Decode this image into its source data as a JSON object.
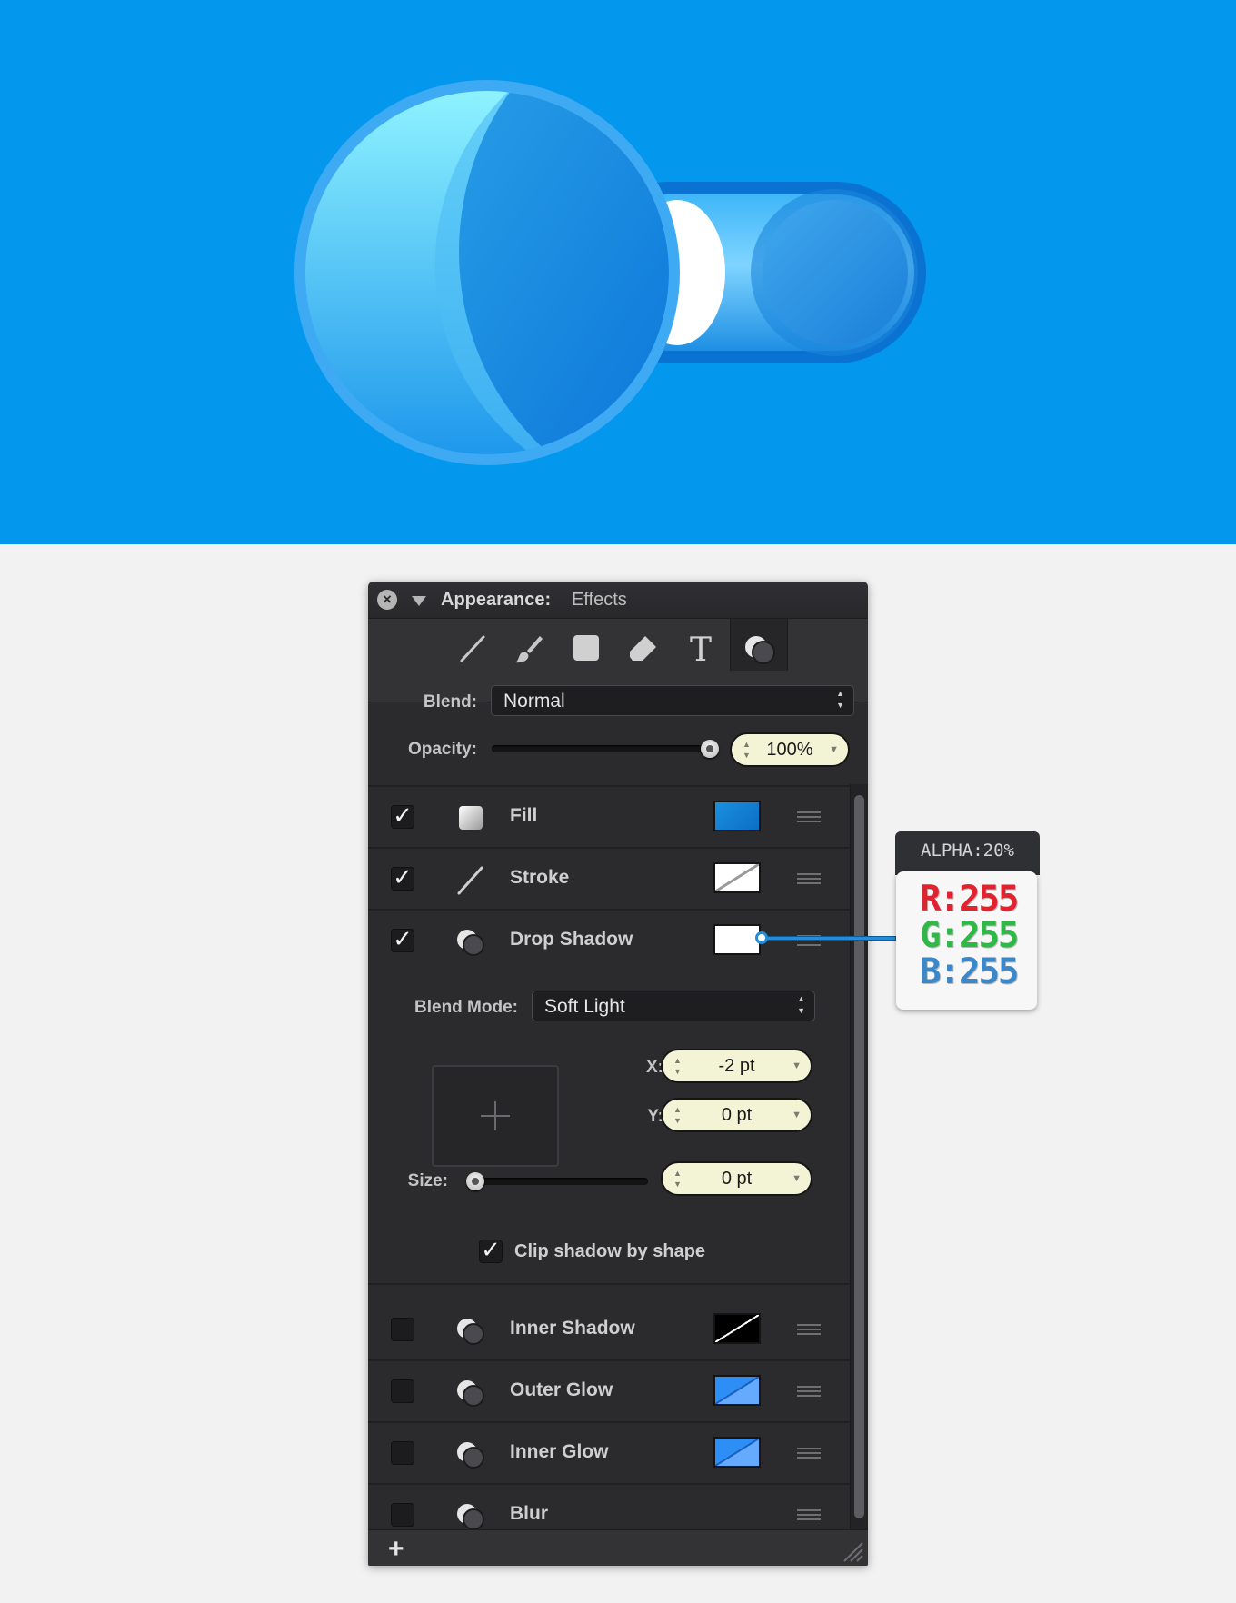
{
  "colors": {
    "hero_background": "#0398ee",
    "panel_background": "#2b2b2e",
    "fill_swatch": "#1a8fe0",
    "outer_glow_swatch": "#2d8ef5",
    "inner_glow_swatch": "#2d8ef5",
    "red": "#e0232f",
    "green": "#2fb846",
    "blue": "#3a87c9"
  },
  "panel": {
    "title_label": "Appearance:",
    "title_value": "Effects",
    "toolbar_icons": [
      "line-tool-icon",
      "brush-tool-icon",
      "rectangle-tool-icon",
      "eraser-tool-icon",
      "text-tool-icon",
      "effects-tool-icon"
    ],
    "text_tool_glyph": "T",
    "blend_label": "Blend:",
    "blend_value": "Normal",
    "opacity_label": "Opacity:",
    "opacity_value": "100%",
    "opacity_level": 1.0,
    "effects": [
      {
        "name": "Fill",
        "checked": true,
        "check_glyph": "✓"
      },
      {
        "name": "Stroke",
        "checked": true,
        "check_glyph": "✓"
      },
      {
        "name": "Drop Shadow",
        "checked": true,
        "check_glyph": "✓"
      },
      {
        "name": "Inner Shadow",
        "checked": false
      },
      {
        "name": "Outer Glow",
        "checked": false
      },
      {
        "name": "Inner Glow",
        "checked": false
      },
      {
        "name": "Blur",
        "checked": false
      }
    ],
    "drop_shadow": {
      "blend_mode_label": "Blend Mode:",
      "blend_mode_value": "Soft Light",
      "x_label": "X:",
      "x_value": "-2 pt",
      "y_label": "Y:",
      "y_value": "0 pt",
      "size_label": "Size:",
      "size_value": "0 pt",
      "size_level": 0.0,
      "clip_label": "Clip shadow by shape",
      "clip_checked": true,
      "clip_glyph": "✓"
    },
    "add_glyph": "+"
  },
  "callout": {
    "tab_text": "ALPHA:20%",
    "r_text": "R:255",
    "g_text": "G:255",
    "b_text": "B:255"
  }
}
